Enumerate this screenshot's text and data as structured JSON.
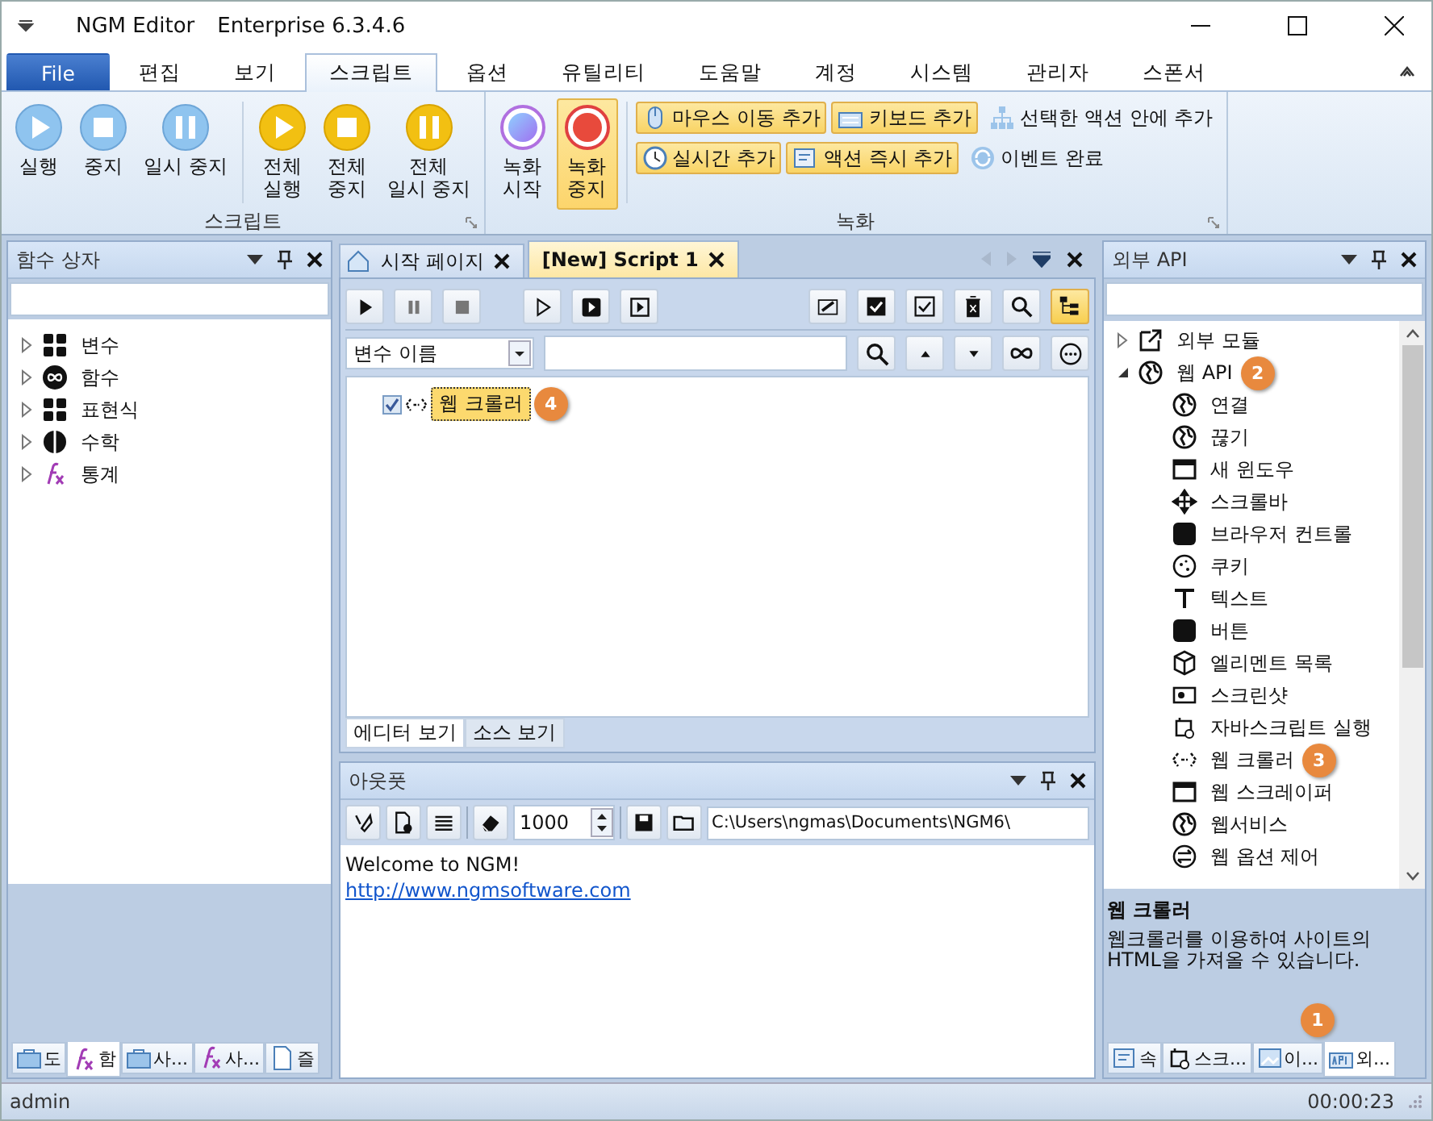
{
  "window": {
    "title": "NGM Editor",
    "edition": "Enterprise 6.3.4.6"
  },
  "menu_tabs": [
    {
      "label": "File",
      "selected": false,
      "kind": "file"
    },
    {
      "label": "편집",
      "selected": false,
      "kind": "tab"
    },
    {
      "label": "보기",
      "selected": false,
      "kind": "tab"
    },
    {
      "label": "스크립트",
      "selected": true,
      "kind": "tab"
    },
    {
      "label": "옵션",
      "selected": false,
      "kind": "tab"
    },
    {
      "label": "유틸리티",
      "selected": false,
      "kind": "tab"
    },
    {
      "label": "도움말",
      "selected": false,
      "kind": "tab"
    },
    {
      "label": "계정",
      "selected": false,
      "kind": "tab"
    },
    {
      "label": "시스템",
      "selected": false,
      "kind": "tab"
    },
    {
      "label": "관리자",
      "selected": false,
      "kind": "tab"
    },
    {
      "label": "스폰서",
      "selected": false,
      "kind": "tab"
    }
  ],
  "script_group": {
    "title": "스크립트",
    "buttons": [
      {
        "label": "실행",
        "color": "#8fc4ef"
      },
      {
        "label": "중지",
        "color": "#8fc4ef"
      },
      {
        "label": "일시 중지",
        "color": "#8fc4ef"
      },
      {
        "label": "전체\n실행",
        "color": "#f2c012"
      },
      {
        "label": "전체\n중지",
        "color": "#f2c012"
      },
      {
        "label": "전체\n일시 중지",
        "color": "#f2c012"
      }
    ]
  },
  "record_group": {
    "title": "녹화",
    "buttons": [
      {
        "label": "녹화\n시작",
        "active": false
      },
      {
        "label": "녹화\n중지",
        "active": true
      }
    ],
    "rows": [
      [
        {
          "label": "마우스 이동 추가",
          "highlighted": true
        },
        {
          "label": "키보드 추가",
          "highlighted": true
        },
        {
          "label": "선택한 액션 안에 추가",
          "highlighted": false
        }
      ],
      [
        {
          "label": "실시간 추가",
          "highlighted": true
        },
        {
          "label": "액션 즉시 추가",
          "highlighted": true
        },
        {
          "label": "이벤트 완료",
          "highlighted": false
        }
      ]
    ]
  },
  "function_box": {
    "title": "함수 상자",
    "items": [
      {
        "label": "변수",
        "expanded": false
      },
      {
        "label": "함수",
        "expanded": false
      },
      {
        "label": "표현식",
        "expanded": false
      },
      {
        "label": "수학",
        "expanded": false
      },
      {
        "label": "통계",
        "expanded": false
      }
    ],
    "bottom_tabs": [
      {
        "label": "도",
        "selected": false
      },
      {
        "label": "함",
        "selected": true
      },
      {
        "label": "사...",
        "selected": false
      },
      {
        "label": "사...",
        "selected": false
      },
      {
        "label": "즐",
        "selected": false
      }
    ]
  },
  "document_tabs": [
    {
      "label": "시작 페이지",
      "selected": false
    },
    {
      "label": "[New] Script 1",
      "selected": true
    }
  ],
  "editor": {
    "filter": "변수 이름",
    "items": [
      {
        "label": "웹 크롤러",
        "checked": true,
        "selected": true,
        "badge": "4"
      }
    ],
    "view_tabs": [
      {
        "label": "에디터 보기",
        "selected": true
      },
      {
        "label": "소스 보기",
        "selected": false
      }
    ]
  },
  "output": {
    "title": "아웃풋",
    "limit": "1000",
    "path": "C:\\Users\\ngmas\\Documents\\NGM6\\",
    "lines": [
      "Welcome to NGM!"
    ],
    "link": "http://www.ngmsoftware.com"
  },
  "external_api": {
    "title": "외부 API",
    "items": [
      {
        "label": "외부 모듈",
        "expanded": false
      },
      {
        "label": "웹 API",
        "expanded": true,
        "badge": "2",
        "children": [
          {
            "label": "연결"
          },
          {
            "label": "끊기"
          },
          {
            "label": "새 윈도우"
          },
          {
            "label": "스크롤바"
          },
          {
            "label": "브라우저 컨트롤"
          },
          {
            "label": "쿠키"
          },
          {
            "label": "텍스트"
          },
          {
            "label": "버튼"
          },
          {
            "label": "엘리멘트 목록"
          },
          {
            "label": "스크린샷"
          },
          {
            "label": "자바스크립트 실행"
          },
          {
            "label": "웹 크롤러",
            "badge": "3"
          },
          {
            "label": "웹 스크레이퍼"
          },
          {
            "label": "웹서비스"
          },
          {
            "label": "웹 옵션 제어"
          }
        ]
      }
    ],
    "description_title": "웹 크롤러",
    "description": "웹크롤러를 이용하여 사이트의 HTML을 가져올 수 있습니다.",
    "bottom_tabs": [
      {
        "label": "속",
        "selected": false
      },
      {
        "label": "스크...",
        "selected": false
      },
      {
        "label": "이...",
        "selected": false
      },
      {
        "label": "외...",
        "selected": true,
        "badge": "1"
      }
    ]
  },
  "status_bar": {
    "user": "admin",
    "time": "00:00:23"
  }
}
